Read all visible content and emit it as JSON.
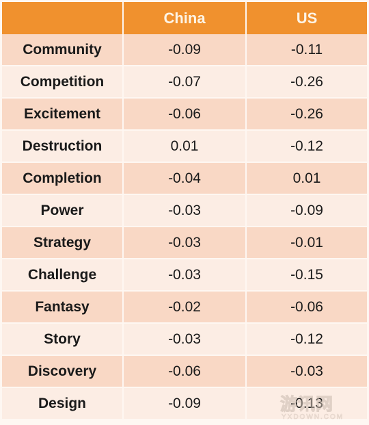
{
  "table": {
    "columns": [
      "",
      "China",
      "US"
    ],
    "rows": [
      {
        "label": "Community",
        "china": "-0.09",
        "us": "-0.11"
      },
      {
        "label": "Competition",
        "china": "-0.07",
        "us": "-0.26"
      },
      {
        "label": "Excitement",
        "china": "-0.06",
        "us": "-0.26"
      },
      {
        "label": "Destruction",
        "china": "0.01",
        "us": "-0.12"
      },
      {
        "label": "Completion",
        "china": "-0.04",
        "us": "0.01"
      },
      {
        "label": "Power",
        "china": "-0.03",
        "us": "-0.09"
      },
      {
        "label": "Strategy",
        "china": "-0.03",
        "us": "-0.01"
      },
      {
        "label": "Challenge",
        "china": "-0.03",
        "us": "-0.15"
      },
      {
        "label": "Fantasy",
        "china": "-0.02",
        "us": "-0.06"
      },
      {
        "label": "Story",
        "china": "-0.03",
        "us": "-0.12"
      },
      {
        "label": "Discovery",
        "china": "-0.06",
        "us": "-0.03"
      },
      {
        "label": "Design",
        "china": "-0.09",
        "us": "-0.13"
      }
    ]
  },
  "watermark": {
    "characters": "游讯网",
    "domain": "YXDOWN.COM"
  },
  "colors": {
    "header_background": "#F0912E",
    "header_text": "#FDF4E6",
    "row_dark": "#F9D8C5",
    "row_light": "#FCEDE4",
    "grid_line": "#FEF7F2",
    "cell_text": "#1A1A1A"
  }
}
